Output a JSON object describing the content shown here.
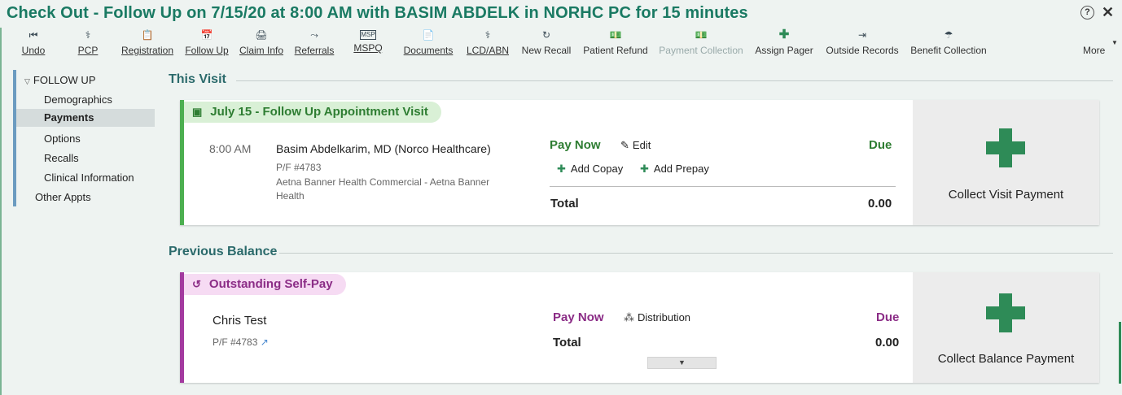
{
  "window": {
    "title": "Check Out - Follow Up on 7/15/20 at 8:00 AM with BASIM ABDELK in NORHC PC for 15 minutes",
    "help_glyph": "?",
    "close_glyph": "✕"
  },
  "toolbar": {
    "items": [
      {
        "label": "Undo",
        "icon": "⏮"
      },
      {
        "label": "PCP",
        "icon": "⚕"
      },
      {
        "label": "Registration",
        "icon": "📋"
      },
      {
        "label": "Follow Up",
        "icon": "📅"
      },
      {
        "label": "Claim Info",
        "icon": "🖨"
      },
      {
        "label": "Referrals",
        "icon": "⤳"
      },
      {
        "label": "MSPQ",
        "icon": "MSP"
      },
      {
        "label": "Documents",
        "icon": "📄"
      },
      {
        "label": "LCD/ABN",
        "icon": "⚕"
      },
      {
        "label": "New Recall",
        "icon": "↻"
      },
      {
        "label": "Patient Refund",
        "icon": "💵"
      },
      {
        "label": "Payment Collection",
        "icon": "💵"
      },
      {
        "label": "Assign Pager",
        "icon": "✚"
      },
      {
        "label": "Outside Records",
        "icon": "⇥"
      },
      {
        "label": "Benefit Collection",
        "icon": "☂"
      }
    ],
    "more_label": "More",
    "more_chevron": "▼"
  },
  "sidebar": {
    "group_chevron": "▽",
    "group_label": "FOLLOW UP",
    "items": [
      {
        "label": "Demographics"
      },
      {
        "label": "Payments"
      },
      {
        "label": "Options"
      },
      {
        "label": "Recalls"
      },
      {
        "label": "Clinical Information"
      }
    ],
    "other_label": "Other Appts"
  },
  "this_visit": {
    "section_title": "This Visit",
    "pill_label": "July 15 - Follow Up Appointment Visit",
    "pill_icon": "▣",
    "time": "8:00 AM",
    "provider": "Basim Abdelkarim, MD (Norco Healthcare)",
    "pf": "P/F #4783",
    "insurance_line1": "Aetna Banner Health Commercial - Aetna Banner",
    "insurance_line2": "Health",
    "pay_now_label": "Pay Now",
    "edit_label": "Edit",
    "edit_icon": "✎",
    "due_label": "Due",
    "add_copay_label": "Add Copay",
    "add_prepay_label": "Add Prepay",
    "plus_icon": "✚",
    "total_label": "Total",
    "total_value": "0.00",
    "collect_label": "Collect Visit Payment",
    "accent_color": "#4caf50"
  },
  "previous_balance": {
    "section_title": "Previous Balance",
    "pill_label": "Outstanding Self-Pay",
    "pill_icon": "↺",
    "patient_name": "Chris Test",
    "pf": "P/F #4783",
    "link_icon": "↗",
    "pay_now_label": "Pay Now",
    "distribution_label": "Distribution",
    "distribution_icon": "⁂",
    "due_label": "Due",
    "total_label": "Total",
    "total_value": "0.00",
    "expand_icon": "▼",
    "collect_label": "Collect Balance Payment",
    "accent_color": "#a33a9f"
  }
}
